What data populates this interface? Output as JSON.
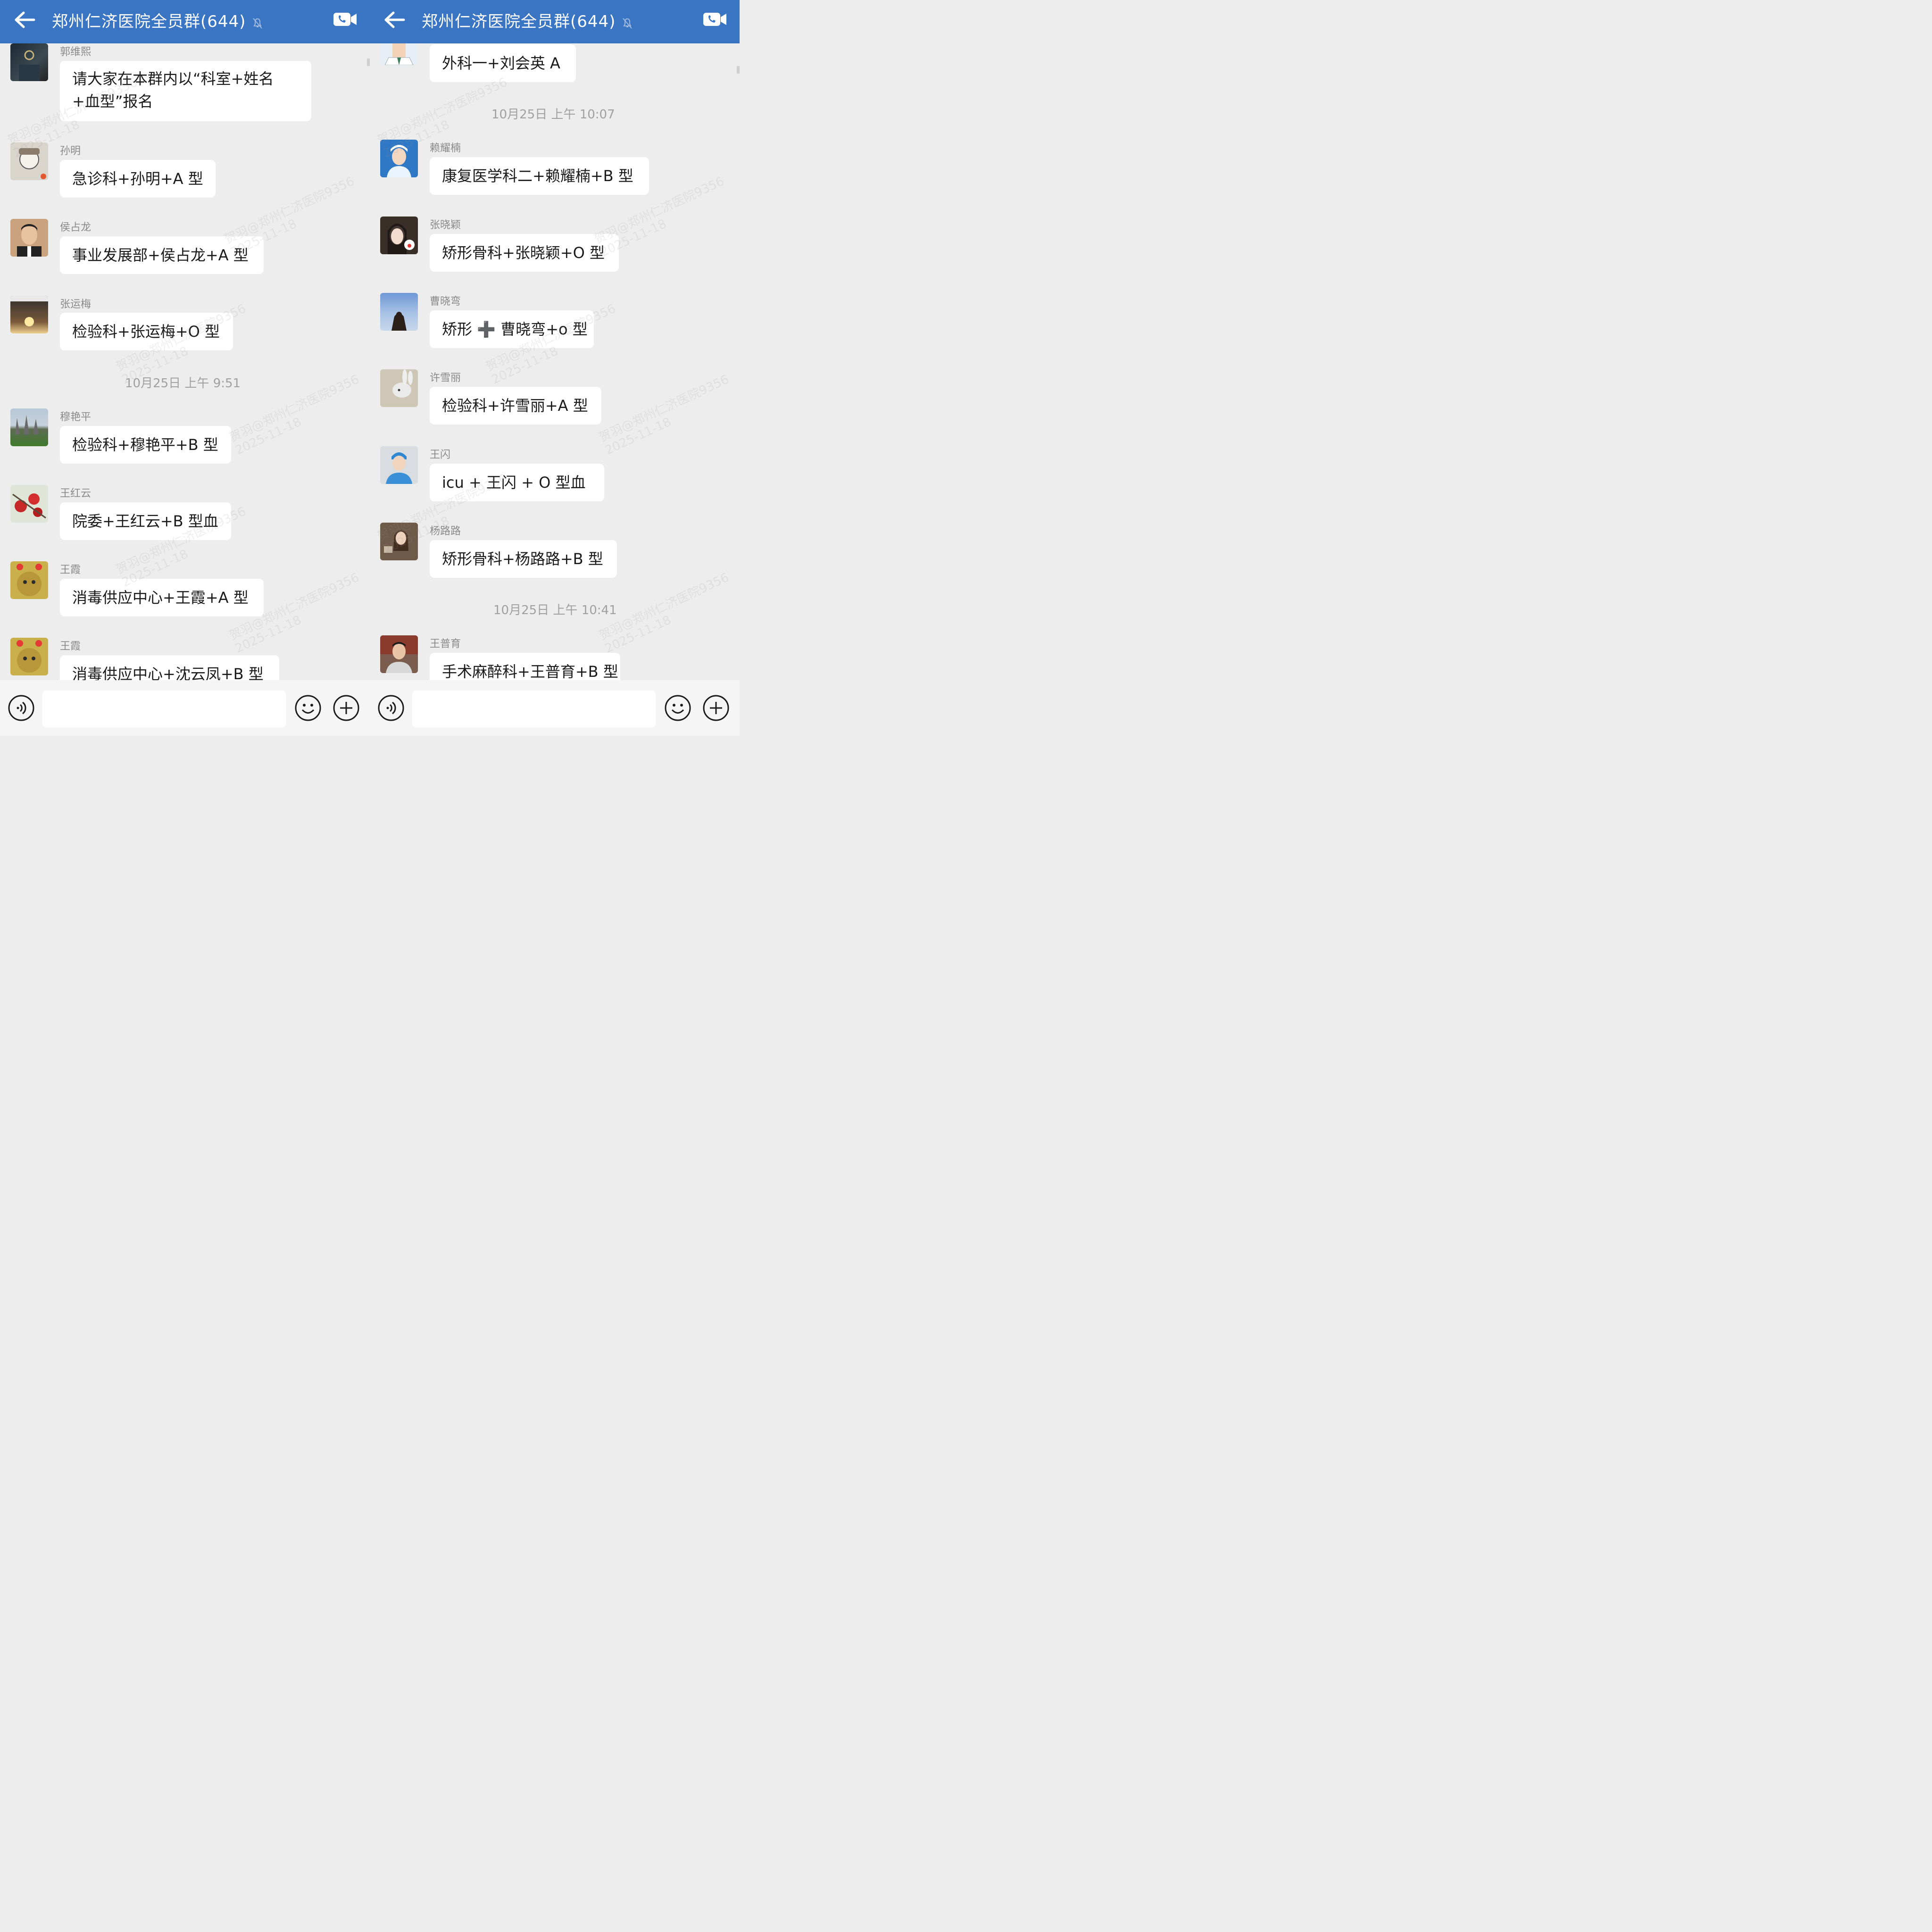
{
  "colors": {
    "header": "#3a75c4",
    "background": "#ededed",
    "bubble": "#ffffff"
  },
  "left": {
    "title": "郑州仁济医院全员群(644)",
    "messages": [
      {
        "sender": "郭维熙",
        "lines": [
          "请大家在本群内以“科室+姓名",
          "+血型”报名"
        ]
      },
      {
        "sender": "孙明",
        "lines": [
          "急诊科+孙明+A 型"
        ]
      },
      {
        "sender": "侯占龙",
        "lines": [
          "事业发展部+侯占龙+A 型"
        ]
      },
      {
        "sender": "张运梅",
        "lines": [
          "检验科+张运梅+O 型"
        ]
      },
      {
        "sender": "穆艳平",
        "lines": [
          "检验科+穆艳平+B 型"
        ]
      },
      {
        "sender": "王红云",
        "lines": [
          "院委+王红云+B 型血"
        ]
      },
      {
        "sender": "王霞",
        "lines": [
          "消毒供应中心+王霞+A 型"
        ]
      },
      {
        "sender": "王霞",
        "lines": [
          "消毒供应中心+沈云凤+B 型"
        ]
      }
    ],
    "timestamps": [
      "10月25日  上午 9:51"
    ]
  },
  "right": {
    "title": "郑州仁济医院全员群(644)",
    "messages": [
      {
        "sender": "",
        "lines": [
          "外科一+刘会英 A"
        ]
      },
      {
        "sender": "赖耀楠",
        "lines": [
          "康复医学科二+赖耀楠+B 型"
        ]
      },
      {
        "sender": "张晓颖",
        "lines": [
          "矫形骨科+张晓颖+O 型"
        ]
      },
      {
        "sender": "曹晓弯",
        "lines": [
          "矫形 ➕ 曹晓弯+o 型"
        ]
      },
      {
        "sender": "许雪丽",
        "lines": [
          "检验科+许雪丽+A 型"
        ]
      },
      {
        "sender": "王闪",
        "lines": [
          "icu  + 王闪 +  O 型血"
        ]
      },
      {
        "sender": "杨路路",
        "lines": [
          "矫形骨科+杨路路+B 型"
        ]
      },
      {
        "sender": "王普育",
        "lines": [
          "手术麻醉科+王普育+B 型"
        ]
      }
    ],
    "timestamps": [
      "10月25日  上午 10:07",
      "10月25日  上午 10:41"
    ]
  },
  "watermark": {
    "line1": "贺羽@郑州仁济医院9356",
    "line2": "2025-11-18"
  },
  "icons": {
    "back": "arrow-left",
    "mute": "bell-off",
    "video": "video-call",
    "voice": "voice-input",
    "emoji": "smiley-face",
    "plus": "add-more"
  }
}
